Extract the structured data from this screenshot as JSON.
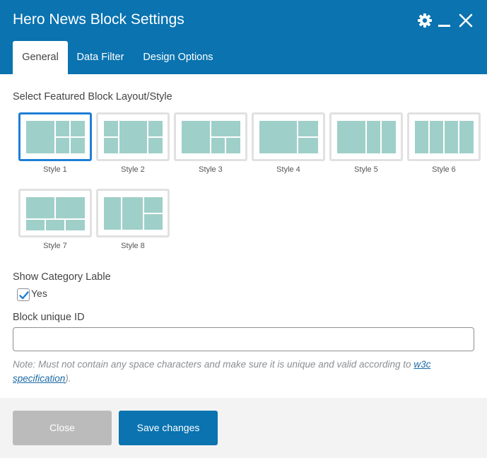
{
  "dialog": {
    "title": "Hero News Block Settings",
    "header_icons": [
      "gear-icon",
      "minimize-icon",
      "close-icon"
    ]
  },
  "tabs": [
    {
      "label": "General",
      "active": true
    },
    {
      "label": "Data Filter",
      "active": false
    },
    {
      "label": "Design Options",
      "active": false
    }
  ],
  "layout": {
    "label": "Select Featured Block Layout/Style",
    "selected": "Style 1",
    "styles": [
      "Style 1",
      "Style 2",
      "Style 3",
      "Style 4",
      "Style 5",
      "Style 6",
      "Style 7",
      "Style 8"
    ]
  },
  "category": {
    "label": "Show Category Lable",
    "checkbox_label": "Yes",
    "checked": true
  },
  "block_id": {
    "label": "Block unique ID",
    "value": "",
    "note_prefix": "Note: Must not contain any space characters and make sure it is unique and valid according to ",
    "link_text": "w3c specification",
    "note_suffix": ")."
  },
  "footer": {
    "close_label": "Close",
    "save_label": "Save changes"
  },
  "colors": {
    "header": "#0a73b0",
    "thumb_fill": "#9fcfc9",
    "selected_border": "#1e7fd6",
    "close_button": "#bbbbbb",
    "save_button": "#0a73b0"
  }
}
